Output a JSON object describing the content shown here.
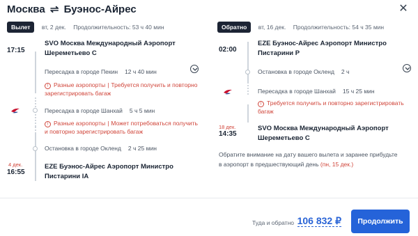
{
  "header": {
    "origin": "Москва",
    "swap_glyph": "⇌",
    "destination": "Буэнос-Айрес",
    "close_glyph": "✕"
  },
  "outbound": {
    "badge": "Вылет",
    "date": "вт, 2 дек.",
    "duration": "Продолжительность: 53 ч 40 мин",
    "departure_time": "17:15",
    "departure_airport": "SVO Москва Международный Аэропорт Шереметьево C",
    "transfer1": {
      "text": "Пересадка в городе Пекин",
      "duration": "12 ч 40 мин"
    },
    "warning1": {
      "a": "Разные аэропорты",
      "b": "Требуется получить и повторно зарегистрировать багаж"
    },
    "transfer2": {
      "text": "Пересадка в городе Шанхай",
      "duration": "5 ч 5 мин"
    },
    "warning2": {
      "a": "Разные аэропорты",
      "b": "Может потребоваться получить и повторно зарегистрировать багаж"
    },
    "stop": {
      "text": "Остановка в городе Окленд",
      "duration": "2 ч 25 мин"
    },
    "arrival_date": "4 дек.",
    "arrival_time": "16:55",
    "arrival_airport": "EZE Буэнос-Айрес Аэропорт Министро Пистарини IA"
  },
  "inbound": {
    "badge": "Обратно",
    "date": "вт, 16 дек.",
    "duration": "Продолжительность: 54 ч 35 мин",
    "departure_time": "02:00",
    "departure_airport": "EZE Буэнос-Айрес Аэропорт Министро Пистарини P",
    "stop": {
      "text": "Остановка в городе Окленд",
      "duration": "2 ч"
    },
    "transfer1": {
      "text": "Пересадка в городе Шанхай",
      "duration": "15 ч 25 мин"
    },
    "warning1": {
      "b": "Требуется получить и повторно зарегистрировать багаж"
    },
    "arrival_date": "18 дек.",
    "arrival_time": "14:35",
    "arrival_airport": "SVO Москва Международный Аэропорт Шереметьево C",
    "notice": "Обратите внимание на дату вашего вылета и заранее прибудьте в аэропорт в предшествующий день",
    "notice_highlight": "(пн, 15 дек.)"
  },
  "footer": {
    "price_label": "Туда и обратно",
    "price": "106 832 ₽",
    "continue_label": "Продолжить"
  },
  "icons": {
    "airline_logo": "china-eastern-logo",
    "chevron": "chevron-down-icon",
    "warning": "warning-icon"
  },
  "colors": {
    "accent": "#2563d9",
    "warning": "#d0453a",
    "badge_bg": "#1c2434"
  }
}
